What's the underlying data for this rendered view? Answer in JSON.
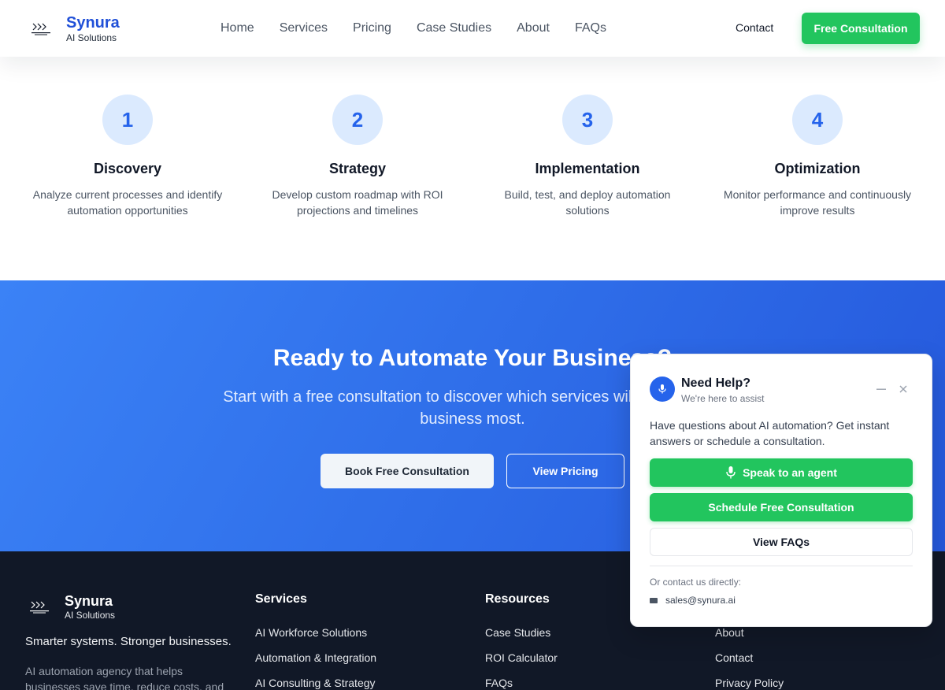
{
  "header": {
    "brand_name": "Synura",
    "brand_sub": "AI Solutions",
    "nav": [
      "Home",
      "Services",
      "Pricing",
      "Case Studies",
      "About",
      "FAQs"
    ],
    "contact": "Contact",
    "cta": "Free Consultation"
  },
  "steps": [
    {
      "num": "1",
      "title": "Discovery",
      "desc": "Analyze current processes and identify automation opportunities"
    },
    {
      "num": "2",
      "title": "Strategy",
      "desc": "Develop custom roadmap with ROI projections and timelines"
    },
    {
      "num": "3",
      "title": "Implementation",
      "desc": "Build, test, and deploy automation solutions"
    },
    {
      "num": "4",
      "title": "Optimization",
      "desc": "Monitor performance and continuously improve results"
    }
  ],
  "cta_band": {
    "title": "Ready to Automate Your Business?",
    "subtitle": "Start with a free consultation to discover which services will benefit your business most.",
    "book_button": "Book Free Consultation",
    "pricing_button": "View Pricing"
  },
  "footer": {
    "brand_name": "Synura",
    "brand_sub": "AI Solutions",
    "tagline": "Smarter systems. Stronger businesses.",
    "about": "AI automation agency that helps businesses save time, reduce costs, and scale smarter.",
    "services": {
      "title": "Services",
      "links": [
        "AI Workforce Solutions",
        "Automation & Integration",
        "AI Consulting & Strategy"
      ]
    },
    "resources": {
      "title": "Resources",
      "links": [
        "Case Studies",
        "ROI Calculator",
        "FAQs"
      ]
    },
    "company": {
      "links": [
        "About",
        "Contact",
        "Privacy Policy"
      ]
    }
  },
  "chat": {
    "title": "Need Help?",
    "subtitle": "We're here to assist",
    "message": "Have questions about AI automation? Get instant answers or schedule a consultation.",
    "speak_button": "Speak to an agent",
    "schedule_button": "Schedule Free Consultation",
    "faq_button": "View FAQs",
    "contact_prompt": "Or contact us directly:",
    "email": "sales@synura.ai"
  },
  "colors": {
    "brand_blue": "#2050d8",
    "accent_green": "#22c55e",
    "step_circle": "#dbeafe",
    "footer_bg": "#111827",
    "band_gradient_start": "#3b82f6",
    "band_gradient_end": "#2558dc"
  }
}
